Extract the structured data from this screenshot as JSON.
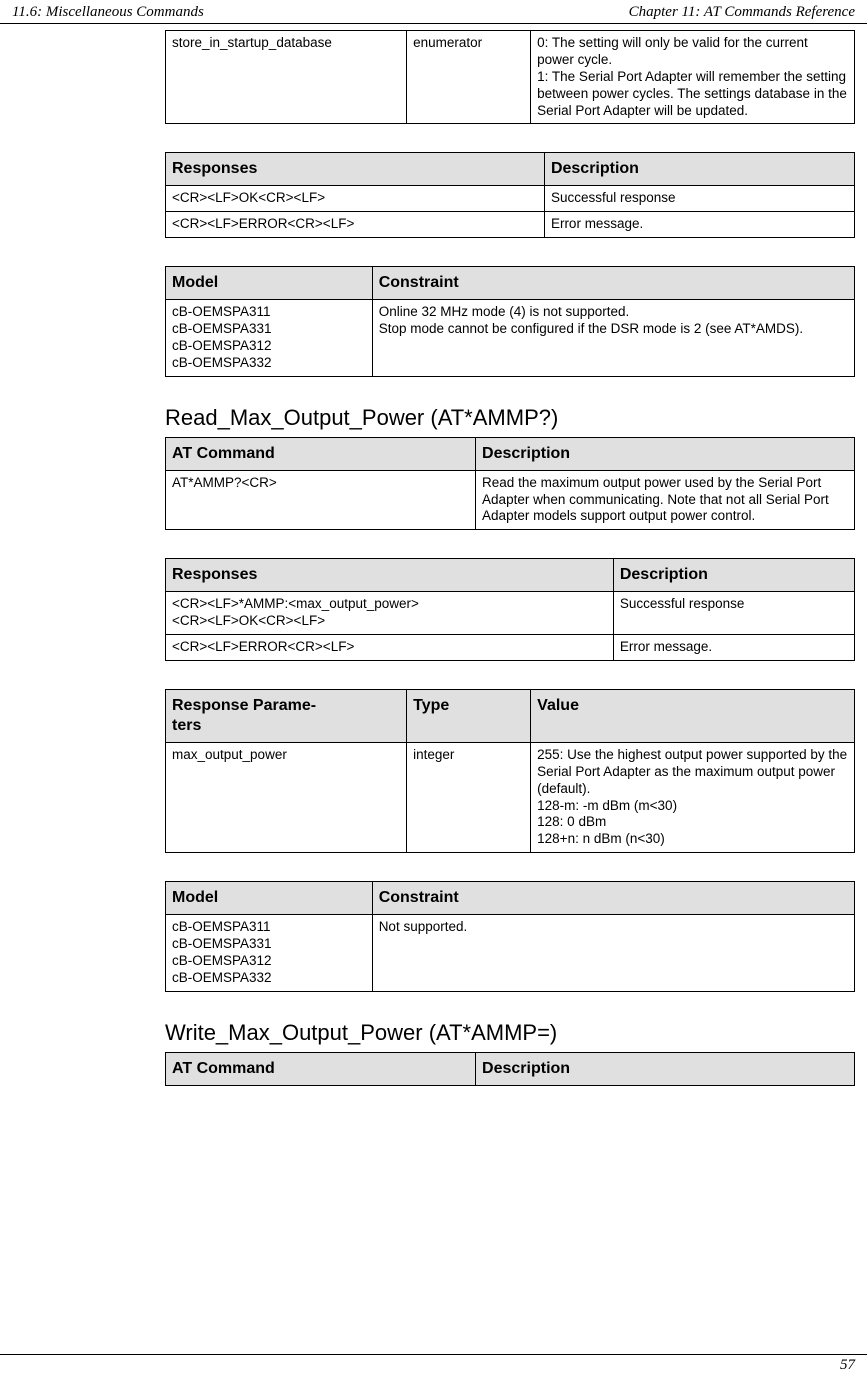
{
  "header": {
    "left": "11.6: Miscellaneous Commands",
    "right": "Chapter 11: AT Commands Reference"
  },
  "footer": {
    "page": "57"
  },
  "table_store": {
    "row": {
      "name": "store_in_startup_database",
      "type": "enumerator",
      "desc": "0: The setting will only be valid for the current power cycle.\n1: The Serial Port Adapter will remember the setting between power cycles. The settings database in the Serial Port Adapter will be updated."
    }
  },
  "table_resp1": {
    "h1": "Responses",
    "h2": "Description",
    "rows": [
      {
        "r": "<CR><LF>OK<CR><LF>",
        "d": "Successful response"
      },
      {
        "r": "<CR><LF>ERROR<CR><LF>",
        "d": "Error message."
      }
    ]
  },
  "table_model1": {
    "h1": "Model",
    "h2": "Constraint",
    "row": {
      "models": "cB-OEMSPA311\ncB-OEMSPA331\ncB-OEMSPA312\ncB-OEMSPA332",
      "constraint": "Online 32 MHz mode (4) is not supported.\nStop mode cannot be configured if the DSR mode is 2 (see AT*AMDS)."
    }
  },
  "section_read": {
    "title": "Read_Max_Output_Power (AT*AMMP?)"
  },
  "table_at1": {
    "h1": "AT Command",
    "h2": "Description",
    "row": {
      "cmd": "AT*AMMP?<CR>",
      "desc": "Read the maximum output power used by the Serial Port Adapter when communicating. Note that not all Serial Port Adapter models support output power control."
    }
  },
  "table_resp2": {
    "h1": "Responses",
    "h2": "Description",
    "rows": [
      {
        "r": "<CR><LF>*AMMP:<max_output_power>\n<CR><LF>OK<CR><LF>",
        "d": "Successful response"
      },
      {
        "r": "<CR><LF>ERROR<CR><LF>",
        "d": "Error message."
      }
    ]
  },
  "table_param": {
    "h1": "Response Parame-\nters",
    "h2": "Type",
    "h3": "Value",
    "row": {
      "name": "max_output_power",
      "type": "integer",
      "value": "255: Use the highest output power supported by the Serial Port Adapter as the maximum output power (default).\n128-m: -m dBm (m<30)\n128: 0 dBm\n128+n: n dBm (n<30)"
    }
  },
  "table_model2": {
    "h1": "Model",
    "h2": "Constraint",
    "row": {
      "models": "cB-OEMSPA311\ncB-OEMSPA331\ncB-OEMSPA312\ncB-OEMSPA332",
      "constraint": "Not supported."
    }
  },
  "section_write": {
    "title": "Write_Max_Output_Power (AT*AMMP=)"
  },
  "table_at2": {
    "h1": "AT Command",
    "h2": "Description"
  }
}
